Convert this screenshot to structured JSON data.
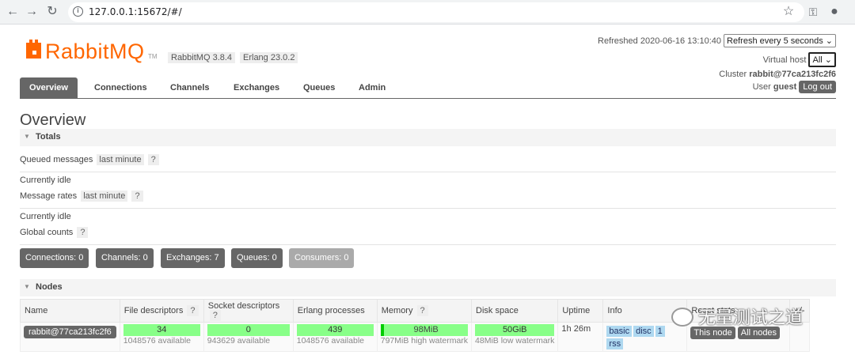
{
  "browser": {
    "url": "127.0.0.1:15672/#/",
    "back_icon": "arrow-left-icon",
    "forward_icon": "arrow-right-icon",
    "reload_icon": "reload-icon"
  },
  "header": {
    "logo_text": "RabbitMQ",
    "logo_tm": "TM",
    "rabbitmq_version": "RabbitMQ 3.8.4",
    "erlang_version": "Erlang 23.0.2",
    "refreshed_label": "Refreshed 2020-06-16 13:10:40",
    "refresh_select": "Refresh every 5 seconds",
    "vhost_label": "Virtual host",
    "vhost_select": "All",
    "cluster_label": "Cluster",
    "cluster_name": "rabbit@77ca213fc2f6",
    "user_label": "User",
    "user_name": "guest",
    "logout_label": "Log out"
  },
  "tabs": [
    "Overview",
    "Connections",
    "Channels",
    "Exchanges",
    "Queues",
    "Admin"
  ],
  "page_title": "Overview",
  "totals": {
    "section_title": "Totals",
    "queued_label": "Queued messages",
    "queued_tag": "last minute",
    "help": "?",
    "queued_status": "Currently idle",
    "rates_label": "Message rates",
    "rates_tag": "last minute",
    "rates_status": "Currently idle",
    "global_label": "Global counts"
  },
  "counts": [
    "Connections: 0",
    "Channels: 0",
    "Exchanges: 7",
    "Queues: 0",
    "Consumers: 0"
  ],
  "nodes": {
    "section_title": "Nodes",
    "headers": {
      "name": "Name",
      "fd": "File descriptors",
      "sd": "Socket descriptors",
      "ep": "Erlang processes",
      "mem": "Memory",
      "disk": "Disk space",
      "uptime": "Uptime",
      "info": "Info",
      "reset": "Reset stats",
      "plus": "+/-"
    },
    "row": {
      "name": "rabbit@77ca213fc2f6",
      "fd_used": "34",
      "fd_avail": "1048576 available",
      "sd_used": "0",
      "sd_avail": "943629 available",
      "ep_used": "439",
      "ep_avail": "1048576 available",
      "mem_used": "98MiB",
      "mem_fraction": 0.04,
      "mem_watermark": "797MiB high watermark",
      "disk_free": "50GiB",
      "disk_watermark": "48MiB low watermark",
      "uptime": "1h 26m",
      "info_tags": [
        "basic",
        "disc",
        "1",
        "rss"
      ],
      "reset_this": "This node",
      "reset_all": "All nodes"
    }
  },
  "watermark_text": "无量测试之道"
}
